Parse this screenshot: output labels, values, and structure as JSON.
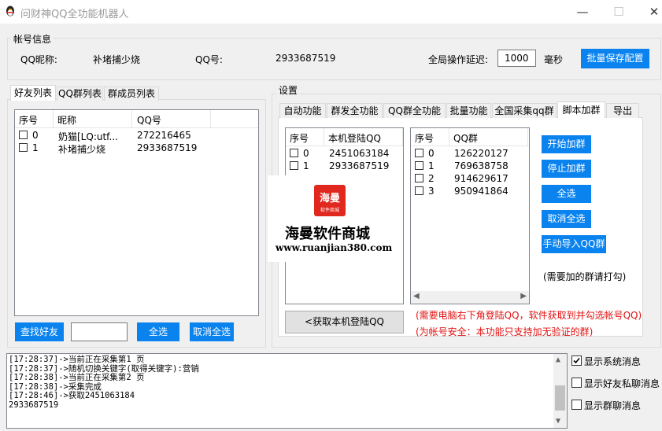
{
  "window": {
    "title": "问财神QQ全功能机器人",
    "minimize": "—",
    "maximize": "☐",
    "close": "✕"
  },
  "account": {
    "group_title": "帐号信息",
    "nickname_label": "QQ昵称:",
    "nickname_value": "补堵捕少烧",
    "qq_label": "QQ号:",
    "qq_value": "2933687519",
    "delay_label": "全局操作延迟:",
    "delay_value": "1000",
    "delay_unit": "毫秒",
    "save_button": "批量保存配置"
  },
  "left_panel": {
    "tabs": [
      "好友列表",
      "QQ群列表",
      "群成员列表"
    ],
    "columns": [
      "序号",
      "昵称",
      "QQ号"
    ],
    "rows": [
      {
        "index": "0",
        "nickname": "奶猫[LQ:utf...",
        "qq": "272216465"
      },
      {
        "index": "1",
        "nickname": "补堵捕少烧",
        "qq": "2933687519"
      }
    ],
    "find_button": "查找好友",
    "search_value": "",
    "select_all_button": "全选",
    "deselect_all_button": "取消全选"
  },
  "settings": {
    "group_title": "设置",
    "tabs": [
      "自动功能",
      "群发全功能",
      "QQ群全功能",
      "批量功能",
      "全国采集qq群",
      "脚本加群",
      "导出"
    ],
    "active_tab": "脚本加群",
    "local_list": {
      "columns": [
        "序号",
        "本机登陆QQ"
      ],
      "rows": [
        {
          "index": "0",
          "qq": "2451063184"
        },
        {
          "index": "1",
          "qq": "2933687519"
        }
      ]
    },
    "group_list": {
      "columns": [
        "序号",
        "QQ群"
      ],
      "rows": [
        {
          "index": "0",
          "group": "126220127"
        },
        {
          "index": "1",
          "group": "769638758"
        },
        {
          "index": "2",
          "group": "914629617"
        },
        {
          "index": "3",
          "group": "950941864"
        }
      ]
    },
    "buttons": {
      "start": "开始加群",
      "stop": "停止加群",
      "select_all": "全选",
      "deselect_all": "取消全选",
      "import": "手动导入QQ群"
    },
    "hint": "(需要加的群请打勾)",
    "fetch_button": "<获取本机登陆QQ",
    "note1": "(需要电脑右下角登陆QQ，软件获取到并勾选帐号QQ)",
    "note2": "(为帐号安全：本功能只支持加无验证的群)"
  },
  "watermark": {
    "logo_text": "海曼",
    "logo_sub": "软件商城",
    "name": "海曼软件商城",
    "url": "www.ruanjian380.com"
  },
  "log": {
    "lines": [
      "[17:28:37]->当前正在采集第1 页",
      "[17:28:37]->随机切换关键字(取得关键字):营销",
      "[17:28:38]->当前正在采集第2 页",
      "[17:28:38]->采集完成",
      "[17:28:46]->获取2451063184",
      "2933687519"
    ]
  },
  "options": [
    {
      "label": "显示系统消息",
      "checked": true
    },
    {
      "label": "显示好友私聊消息",
      "checked": false
    },
    {
      "label": "显示群聊消息",
      "checked": false
    }
  ],
  "colors": {
    "accent": "#0a83ef",
    "warning": "#e01010"
  }
}
